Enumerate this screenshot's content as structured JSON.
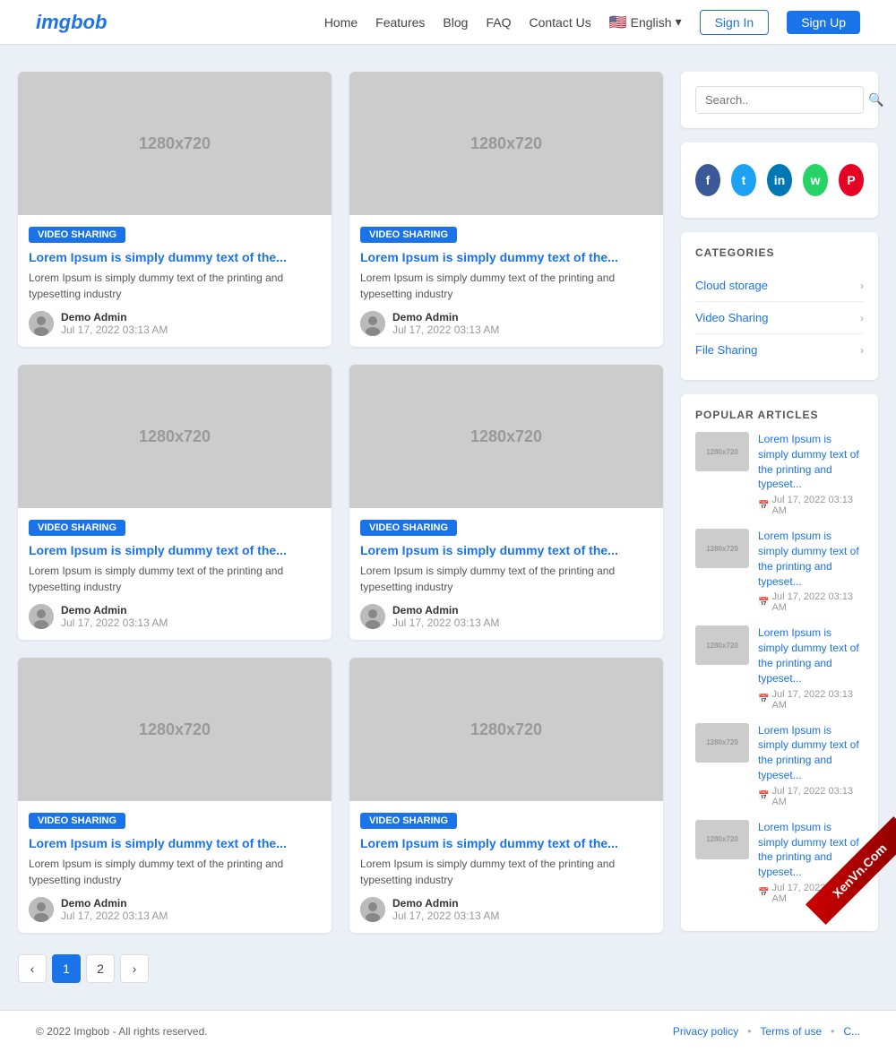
{
  "site": {
    "logo": "imgbob",
    "nav": {
      "home": "Home",
      "features": "Features",
      "blog": "Blog",
      "faq": "FAQ",
      "contact": "Contact Us",
      "language": "English",
      "signin": "Sign In",
      "signup": "Sign Up"
    }
  },
  "articles": [
    {
      "tag": "VIDEO SHARING",
      "title": "Lorem Ipsum is simply dummy text of the...",
      "desc": "Lorem Ipsum is simply dummy text of the printing and typesetting industry",
      "author": "Demo Admin",
      "date": "Jul 17, 2022 03:13 AM",
      "dim": "1280x720"
    },
    {
      "tag": "VIDEO SHARING",
      "title": "Lorem Ipsum is simply dummy text of the...",
      "desc": "Lorem Ipsum is simply dummy text of the printing and typesetting industry",
      "author": "Demo Admin",
      "date": "Jul 17, 2022 03:13 AM",
      "dim": "1280x720"
    },
    {
      "tag": "VIDEO SHARING",
      "title": "Lorem Ipsum is simply dummy text of the...",
      "desc": "Lorem Ipsum is simply dummy text of the printing and typesetting industry",
      "author": "Demo Admin",
      "date": "Jul 17, 2022 03:13 AM",
      "dim": "1280x720"
    },
    {
      "tag": "VIDEO SHARING",
      "title": "Lorem Ipsum is simply dummy text of the...",
      "desc": "Lorem Ipsum is simply dummy text of the printing and typesetting industry",
      "author": "Demo Admin",
      "date": "Jul 17, 2022 03:13 AM",
      "dim": "1280x720"
    },
    {
      "tag": "VIDEO SHARING",
      "title": "Lorem Ipsum is simply dummy text of the...",
      "desc": "Lorem Ipsum is simply dummy text of the printing and typesetting industry",
      "author": "Demo Admin",
      "date": "Jul 17, 2022 03:13 AM",
      "dim": "1280x720"
    },
    {
      "tag": "VIDEO SHARING",
      "title": "Lorem Ipsum is simply dummy text of the...",
      "desc": "Lorem Ipsum is simply dummy text of the printing and typesetting industry",
      "author": "Demo Admin",
      "date": "Jul 17, 2022 03:13 AM",
      "dim": "1280x720"
    }
  ],
  "pagination": {
    "prev": "‹",
    "page1": "1",
    "page2": "2",
    "next": "›"
  },
  "sidebar": {
    "search_placeholder": "Search..",
    "categories_title": "CATEGORIES",
    "categories": [
      {
        "name": "Cloud storage"
      },
      {
        "name": "Video Sharing"
      },
      {
        "name": "File Sharing"
      }
    ],
    "popular_title": "POPULAR ARTICLES",
    "popular": [
      {
        "title": "Lorem Ipsum is simply dummy text of the printing and typeset...",
        "date": "Jul 17, 2022 03:13 AM",
        "dim": "1280x720"
      },
      {
        "title": "Lorem Ipsum is simply dummy text of the printing and typeset...",
        "date": "Jul 17, 2022 03:13 AM",
        "dim": "1280x720"
      },
      {
        "title": "Lorem Ipsum is simply dummy text of the printing and typeset...",
        "date": "Jul 17, 2022 03:13 AM",
        "dim": "1280x720"
      },
      {
        "title": "Lorem Ipsum is simply dummy text of the printing and typeset...",
        "date": "Jul 17, 2022 03:13 AM",
        "dim": "1280x720"
      },
      {
        "title": "Lorem Ipsum is simply dummy text of the printing and typeset...",
        "date": "Jul 17, 2022 03:13 AM",
        "dim": "1280x720"
      }
    ]
  },
  "footer": {
    "copyright": "© 2022 Imgbob - All rights reserved.",
    "links": [
      "Privacy policy",
      "Terms of use",
      "C..."
    ]
  },
  "watermark": "XenVn.Com"
}
